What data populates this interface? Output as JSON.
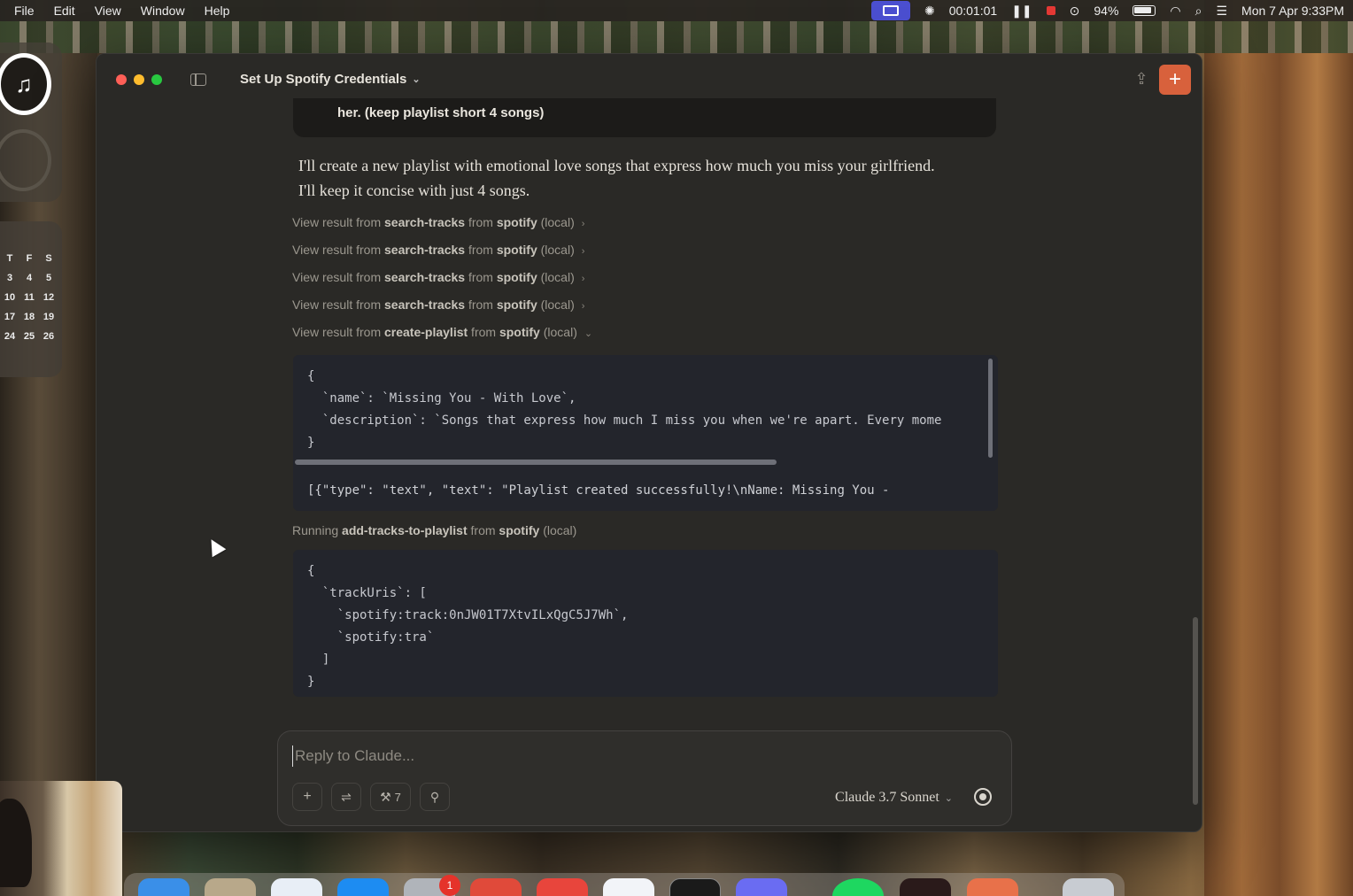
{
  "menubar": {
    "items": [
      "File",
      "Edit",
      "View",
      "Window",
      "Help"
    ],
    "timer": "00:01:01",
    "battery": "94%",
    "datetime": "Mon 7 Apr  9:33PM"
  },
  "calendar": {
    "header": [
      "T",
      "F",
      "S"
    ],
    "rows": [
      [
        "3",
        "4",
        "5"
      ],
      [
        "10",
        "11",
        "12"
      ],
      [
        "17",
        "18",
        "19"
      ],
      [
        "24",
        "25",
        "26"
      ]
    ]
  },
  "window": {
    "title": "Set Up Spotify Credentials"
  },
  "chat": {
    "user_message_tail": "her. (keep playlist short 4 songs)",
    "assistant_text": "I'll create a new playlist with emotional love songs that express how much you miss your girlfriend. I'll keep it concise with just 4 songs.",
    "tool_results": [
      {
        "prefix": "View result from ",
        "tool": "search-tracks",
        "mid": " from ",
        "server": "spotify",
        "suffix": " (local)"
      },
      {
        "prefix": "View result from ",
        "tool": "search-tracks",
        "mid": " from ",
        "server": "spotify",
        "suffix": " (local)"
      },
      {
        "prefix": "View result from ",
        "tool": "search-tracks",
        "mid": " from ",
        "server": "spotify",
        "suffix": " (local)"
      },
      {
        "prefix": "View result from ",
        "tool": "search-tracks",
        "mid": " from ",
        "server": "spotify",
        "suffix": " (local)"
      },
      {
        "prefix": "View result from ",
        "tool": "create-playlist",
        "mid": " from ",
        "server": "spotify",
        "suffix": " (local)"
      }
    ],
    "create_playlist_input": [
      "{",
      "  `name`: `Missing You - With Love`,",
      "  `description`: `Songs that express how much I miss you when we're apart. Every mome",
      "}"
    ],
    "create_playlist_result": "[{\"type\": \"text\", \"text\": \"Playlist created successfully!\\nName: Missing You -",
    "running": {
      "prefix": "Running ",
      "tool": "add-tracks-to-playlist",
      "mid": " from ",
      "server": "spotify",
      "suffix": " (local)"
    },
    "add_tracks_input": [
      "{",
      "  `trackUris`: [",
      "    `spotify:track:0nJW01T7XtvILxQgC5J7Wh`,",
      "    `spotify:tra`",
      "  ]",
      "}"
    ]
  },
  "composer": {
    "placeholder": "Reply to Claude...",
    "tools_count": "7",
    "model": "Claude 3.7 Sonnet"
  },
  "dock": {
    "badge": "1"
  },
  "colors": {
    "accent": "#d8613c",
    "window_bg": "#2a2926",
    "code_bg": "#23252c"
  }
}
